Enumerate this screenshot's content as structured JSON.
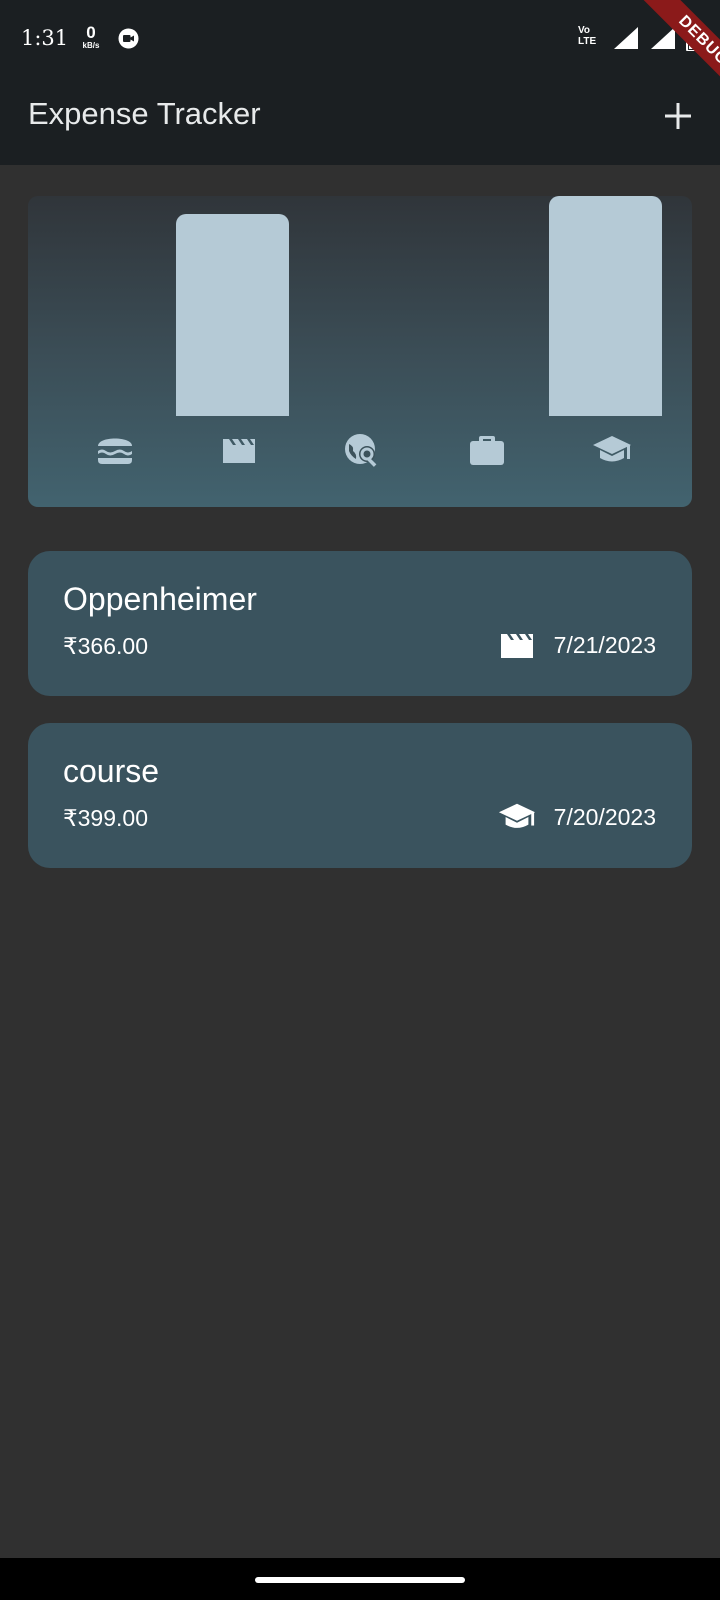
{
  "status_bar": {
    "time": "1:31",
    "net_speed_value": "0",
    "net_speed_unit": "kB/s",
    "volte_top": "Vo",
    "volte_bottom": "LTE",
    "debug_label": "DEBUG"
  },
  "app_bar": {
    "title": "Expense Tracker",
    "add_icon": "plus-icon"
  },
  "chart": {
    "bars": [
      {
        "category": "food",
        "icon": "hamburger-icon",
        "level": 0.0
      },
      {
        "category": "leisure",
        "icon": "movie-clapper-icon",
        "level": 0.92
      },
      {
        "category": "travel",
        "icon": "travel-explore-icon",
        "level": 0.0
      },
      {
        "category": "work",
        "icon": "briefcase-icon",
        "level": 0.0
      },
      {
        "category": "education",
        "icon": "graduation-cap-icon",
        "level": 1.0
      }
    ],
    "bar_color": "#b5cad6",
    "gradient": [
      "#30353a",
      "#42636f"
    ]
  },
  "expenses": [
    {
      "title": "Oppenheimer",
      "amount": "₹366.00",
      "date": "7/21/2023",
      "icon": "movie-clapper-icon"
    },
    {
      "title": "course",
      "amount": "₹399.00",
      "date": "7/20/2023",
      "icon": "graduation-cap-icon"
    }
  ],
  "colors": {
    "background": "#303030",
    "app_bar": "#1b1f22",
    "card": "#3a535e",
    "debug_ribbon": "#8b1a1a"
  }
}
